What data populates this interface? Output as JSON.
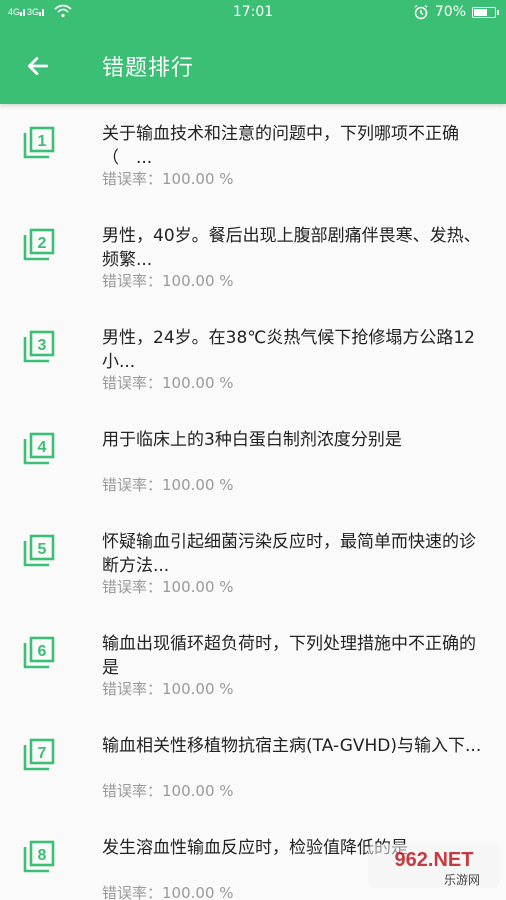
{
  "status_bar": {
    "left": "4G 3G",
    "time": "17:01",
    "battery": "70%",
    "battery_level": 0.7
  },
  "app_bar": {
    "title": "错题排行"
  },
  "list": {
    "items": [
      {
        "num": "1",
        "text": "关于输血技术和注意的问题中，下列哪项不正确（　...",
        "rate": "错误率：100.00 %"
      },
      {
        "num": "2",
        "text": "男性，40岁。餐后出现上腹部剧痛伴畏寒、发热、频繁...",
        "rate": "错误率：100.00 %"
      },
      {
        "num": "3",
        "text": "男性，24岁。在38℃炎热气候下抢修塌方公路12小...",
        "rate": "错误率：100.00 %"
      },
      {
        "num": "4",
        "text": "用于临床上的3种白蛋白制剂浓度分别是",
        "rate": "错误率：100.00 %"
      },
      {
        "num": "5",
        "text": "怀疑输血引起细菌污染反应时，最简单而快速的诊断方法...",
        "rate": "错误率：100.00 %"
      },
      {
        "num": "6",
        "text": "输血出现循环超负荷时，下列处理措施中不正确的是",
        "rate": "错误率：100.00 %"
      },
      {
        "num": "7",
        "text": "输血相关性移植物抗宿主病(TA-GVHD)与输入下...",
        "rate": "错误率：100.00 %"
      },
      {
        "num": "8",
        "text": "发生溶血性输血反应时，检验值降低的是",
        "rate": "错误率：100.00 %"
      }
    ]
  },
  "watermark": {
    "text": "962.NET",
    "subtext": "乐游网"
  },
  "colors": {
    "primary": "#3bbf75",
    "icon_green": "#3bbf75",
    "text": "#222222",
    "subtext": "#9a9a9a"
  }
}
